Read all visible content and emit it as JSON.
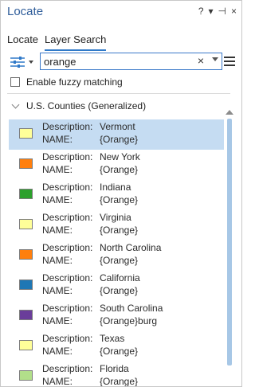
{
  "window": {
    "title": "Locate",
    "controls": [
      "?",
      "▾",
      "⊣",
      "×"
    ]
  },
  "tabs": [
    {
      "label": "Locate",
      "active": false
    },
    {
      "label": "Layer Search",
      "active": true
    }
  ],
  "search": {
    "value": "orange",
    "clear_glyph": "×"
  },
  "fuzzy": {
    "label": "Enable fuzzy matching",
    "checked": false
  },
  "results": {
    "group_label": "U.S. Counties (Generalized)",
    "keys": {
      "description": "Description:",
      "name": "NAME:"
    },
    "items": [
      {
        "description": "Vermont",
        "name": "{Orange}",
        "color": "#ffff99",
        "selected": true
      },
      {
        "description": "New York",
        "name": "{Orange}",
        "color": "#ff7f0e",
        "selected": false
      },
      {
        "description": "Indiana",
        "name": "{Orange}",
        "color": "#2ca02c",
        "selected": false
      },
      {
        "description": "Virginia",
        "name": "{Orange}",
        "color": "#ffff99",
        "selected": false
      },
      {
        "description": "North Carolina",
        "name": "{Orange}",
        "color": "#ff7f0e",
        "selected": false
      },
      {
        "description": "California",
        "name": "{Orange}",
        "color": "#1f77b4",
        "selected": false
      },
      {
        "description": "South Carolina",
        "name": "{Orange}burg",
        "color": "#6a3d9a",
        "selected": false
      },
      {
        "description": "Texas",
        "name": "{Orange}",
        "color": "#ffff99",
        "selected": false
      },
      {
        "description": "Florida",
        "name": "{Orange}",
        "color": "#b2df8a",
        "selected": false
      }
    ]
  },
  "colors": {
    "accent": "#2f79c8",
    "selection": "#c5dcf2",
    "title": "#2f5d9a"
  }
}
